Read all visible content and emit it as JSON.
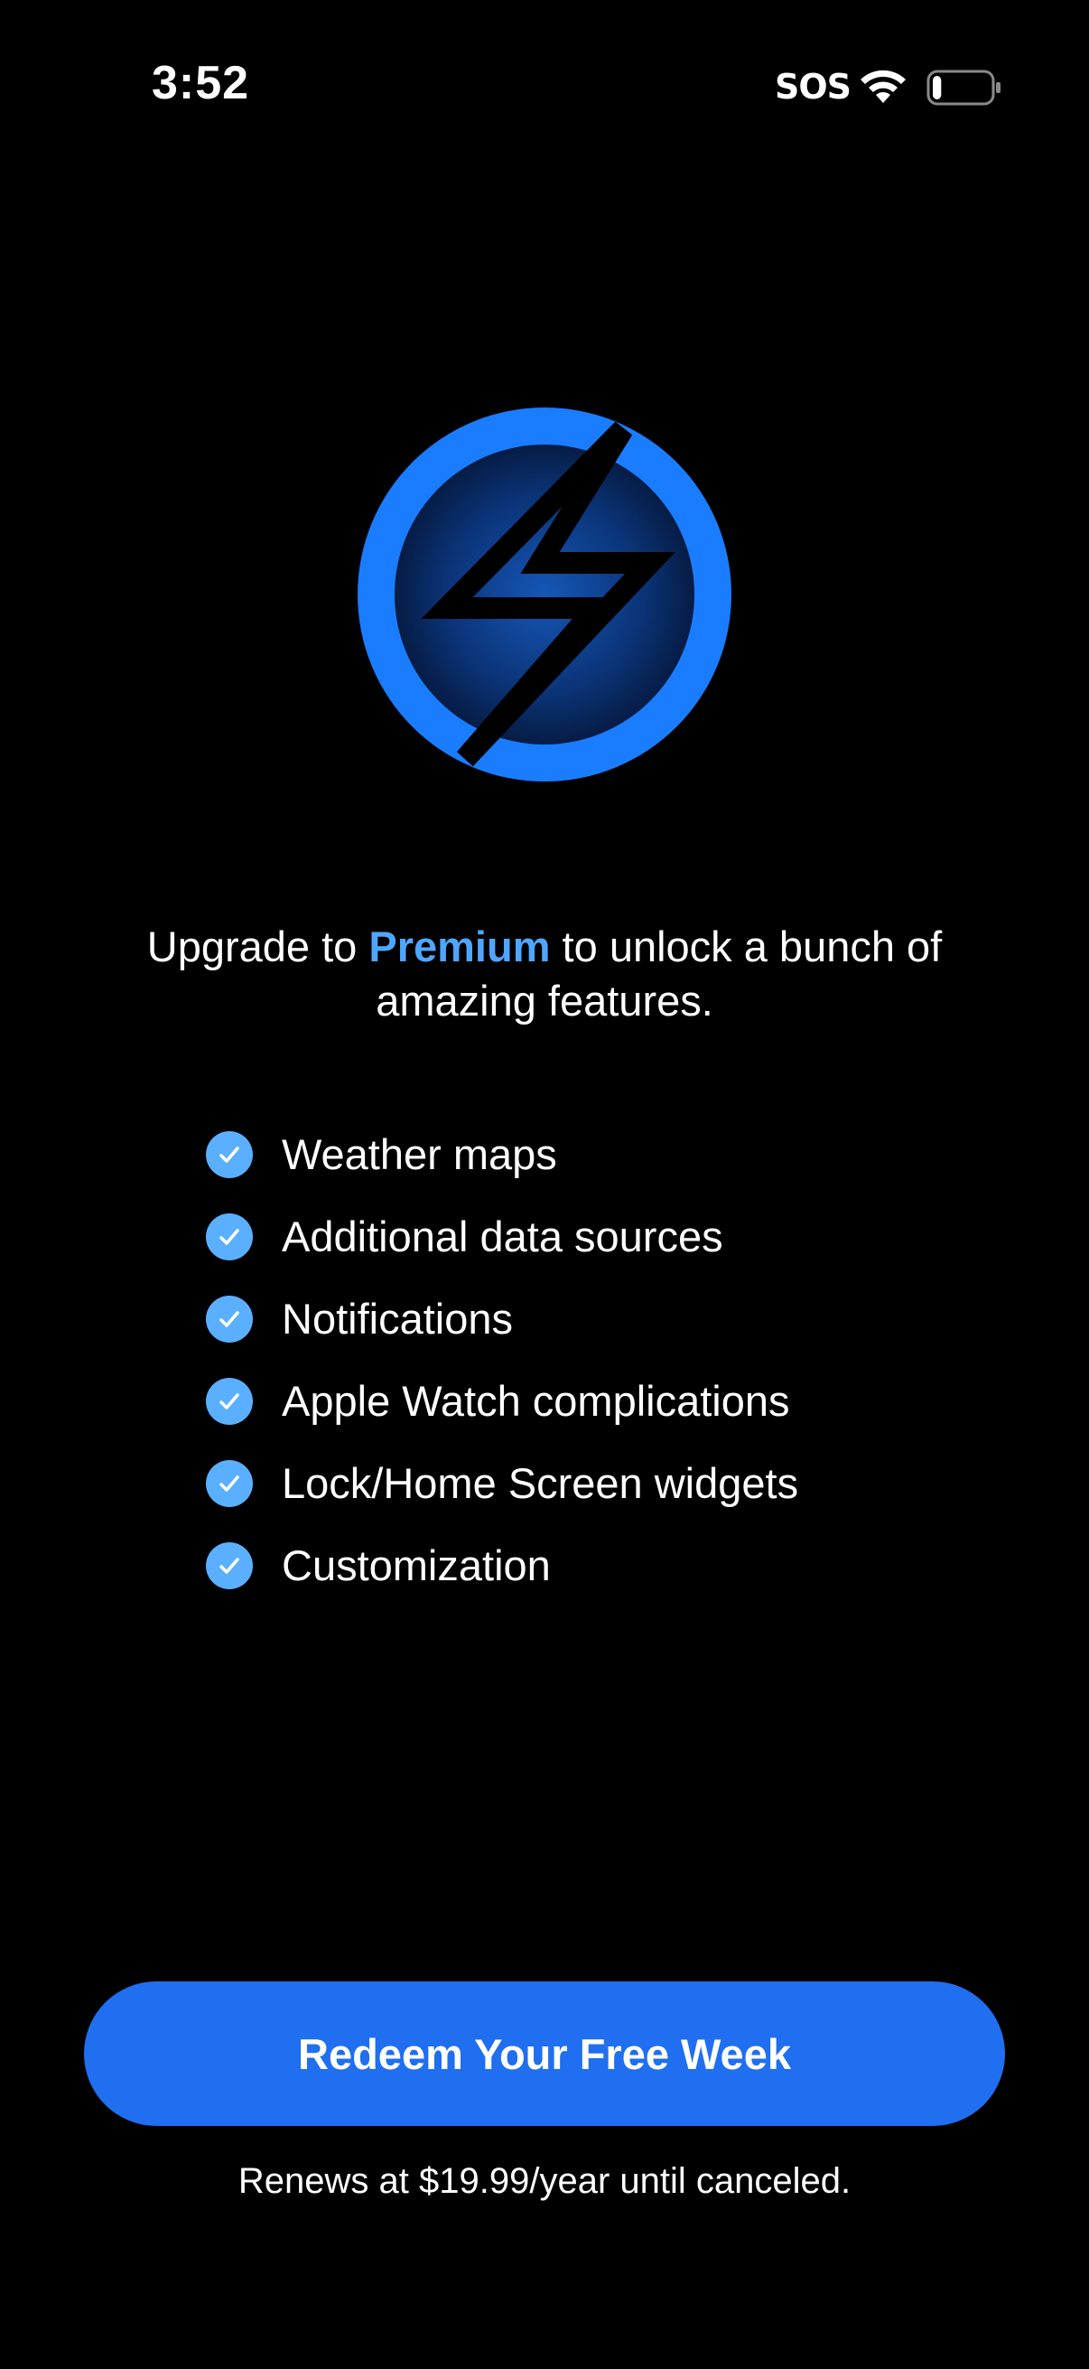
{
  "status_bar": {
    "time": "3:52",
    "carrier": "SOS",
    "wifi_icon": "wifi-icon",
    "battery_icon": "battery-icon",
    "battery_level_fraction": 0.15
  },
  "logo": {
    "icon": "lightning-bolt-icon",
    "ring_color": "#1a7cff"
  },
  "headline": {
    "before": "Upgrade to ",
    "accent": "Premium",
    "after": " to unlock a bunch of amazing features.",
    "accent_color": "#4fa6ff"
  },
  "features": [
    {
      "icon": "checkmark-circle-icon",
      "label": "Weather maps"
    },
    {
      "icon": "checkmark-circle-icon",
      "label": "Additional data sources"
    },
    {
      "icon": "checkmark-circle-icon",
      "label": "Notifications"
    },
    {
      "icon": "checkmark-circle-icon",
      "label": "Apple Watch complications"
    },
    {
      "icon": "checkmark-circle-icon",
      "label": "Lock/Home Screen widgets"
    },
    {
      "icon": "checkmark-circle-icon",
      "label": "Customization"
    }
  ],
  "cta": {
    "label": "Redeem Your Free Week",
    "color": "#1f6ff0"
  },
  "renew_text": "Renews at $19.99/year until canceled."
}
